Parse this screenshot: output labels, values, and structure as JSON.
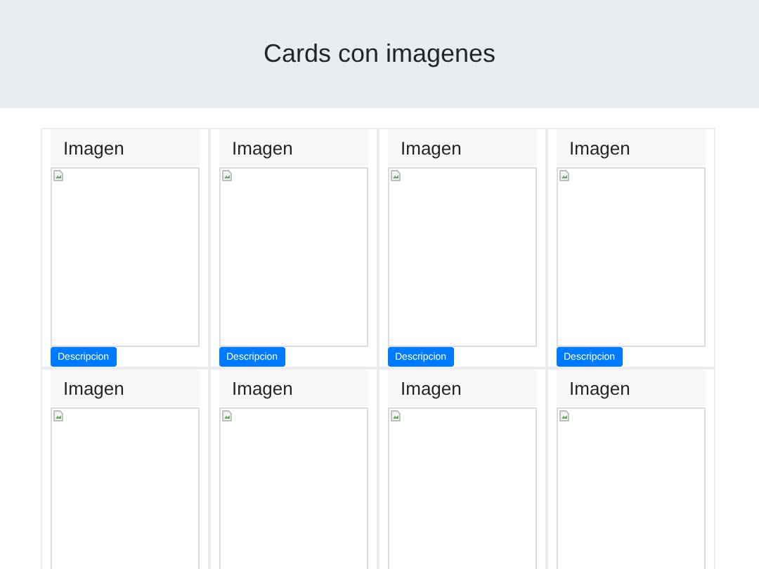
{
  "header": {
    "title": "Cards con imagenes"
  },
  "cards": [
    {
      "title": "Imagen",
      "button": "Descripcion"
    },
    {
      "title": "Imagen",
      "button": "Descripcion"
    },
    {
      "title": "Imagen",
      "button": "Descripcion"
    },
    {
      "title": "Imagen",
      "button": "Descripcion"
    },
    {
      "title": "Imagen"
    },
    {
      "title": "Imagen"
    },
    {
      "title": "Imagen"
    },
    {
      "title": "Imagen"
    }
  ]
}
